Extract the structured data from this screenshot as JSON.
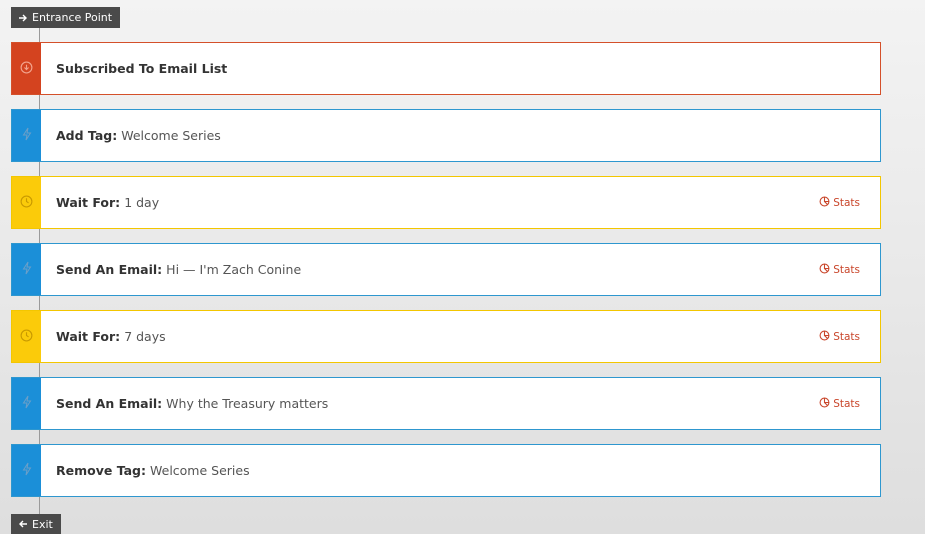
{
  "entrance": {
    "label": "Entrance Point",
    "icon": "arrow-right-icon"
  },
  "exit": {
    "label": "Exit",
    "icon": "arrow-left-icon"
  },
  "colors": {
    "trigger": "#d4431f",
    "action": "#1b8fd8",
    "wait": "#fbcb0a",
    "stats": "#c9462b"
  },
  "steps": [
    {
      "type": "trigger",
      "icon": "arrow-down-circle-icon",
      "label": "Subscribed To Email List",
      "value": "",
      "stats": ""
    },
    {
      "type": "action",
      "icon": "lightning-icon",
      "label": "Add Tag:",
      "value": "Welcome Series",
      "stats": ""
    },
    {
      "type": "wait",
      "icon": "clock-icon",
      "label": "Wait For:",
      "value": "1 day",
      "stats": "Stats"
    },
    {
      "type": "action",
      "icon": "lightning-icon",
      "label": "Send An Email:",
      "value": "Hi — I'm Zach Conine",
      "stats": "Stats"
    },
    {
      "type": "wait",
      "icon": "clock-icon",
      "label": "Wait For:",
      "value": "7 days",
      "stats": "Stats"
    },
    {
      "type": "action",
      "icon": "lightning-icon",
      "label": "Send An Email:",
      "value": "Why the Treasury matters",
      "stats": "Stats"
    },
    {
      "type": "action",
      "icon": "lightning-icon",
      "label": "Remove Tag:",
      "value": "Welcome Series",
      "stats": ""
    }
  ]
}
